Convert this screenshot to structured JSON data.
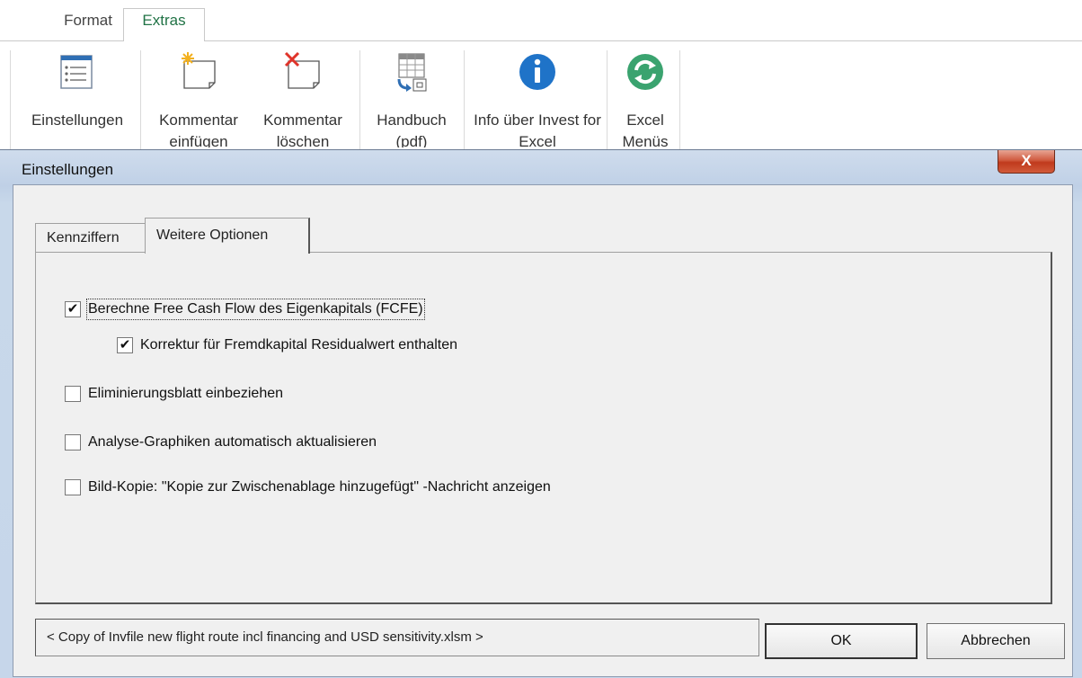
{
  "ribbon": {
    "tabs": [
      {
        "label": "Format",
        "active": false
      },
      {
        "label": "Extras",
        "active": true
      }
    ],
    "buttons": [
      {
        "label": "Einstellungen",
        "icon": "settings-list-icon"
      },
      {
        "label": "Kommentar einfügen",
        "icon": "comment-add-icon"
      },
      {
        "label": "Kommentar löschen",
        "icon": "comment-delete-icon"
      },
      {
        "label": "Handbuch (pdf)",
        "icon": "manual-icon"
      },
      {
        "label": "Info über Invest for Excel",
        "icon": "info-icon"
      },
      {
        "label": "Excel Menüs",
        "icon": "refresh-icon"
      }
    ]
  },
  "dialog": {
    "title": "Einstellungen",
    "close_label": "X",
    "tabs": [
      {
        "label": "Kennziffern",
        "active": false
      },
      {
        "label": "Weitere Optionen",
        "active": true
      }
    ],
    "options": [
      {
        "label": "Berechne Free Cash Flow des Eigenkapitals (FCFE)",
        "checked": true,
        "check_mark": "✔"
      },
      {
        "label": "Korrektur für Fremdkapital Residualwert enthalten",
        "checked": true,
        "check_mark": "✔"
      },
      {
        "label": "Eliminierungsblatt einbeziehen",
        "checked": false,
        "check_mark": ""
      },
      {
        "label": "Analyse-Graphiken automatisch aktualisieren",
        "checked": false,
        "check_mark": ""
      },
      {
        "label": "Bild-Kopie: \"Kopie zur Zwischenablage hinzugefügt\" -Nachricht anzeigen",
        "checked": false,
        "check_mark": ""
      }
    ],
    "file_status": "< Copy of Invfile new flight route incl  financing and USD sensitivity.xlsm >",
    "ok_label": "OK",
    "cancel_label": "Abbrechen"
  },
  "colors": {
    "accent": "#217346",
    "info_blue": "#1f73c8",
    "refresh_green": "#3aa36f",
    "close_red": "#c8452a"
  }
}
